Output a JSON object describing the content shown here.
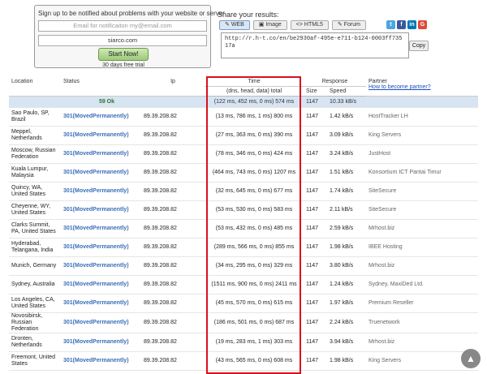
{
  "notify": {
    "label": "Sign up to be notified about problems with your website or server",
    "email_placeholder": "Email for notificaiton my@email.com",
    "domain_value": "siarco.com",
    "start_button": "Start Now!",
    "trial_text": "30 days free trial"
  },
  "share": {
    "title": "Share your results:",
    "tabs": [
      "WEB",
      "Image",
      "HTML5",
      "Forum"
    ],
    "url": "http://r.h-t.co/en/be2930af-495e-e711-b124-0003ff73517a",
    "copy_label": "Copy",
    "social": [
      {
        "name": "twitter-icon",
        "glyph": "t",
        "color": "#4da7de"
      },
      {
        "name": "facebook-icon",
        "glyph": "f",
        "color": "#3b5998"
      },
      {
        "name": "linkedin-icon",
        "glyph": "in",
        "color": "#0077b5"
      },
      {
        "name": "google-plus-icon",
        "glyph": "G",
        "color": "#dd4b39"
      }
    ]
  },
  "table": {
    "headers": {
      "location": "Location",
      "status": "Status",
      "ip": "Ip",
      "time": "Time",
      "time_sub": "(dns, head, data) total",
      "response": "Response",
      "size": "Size",
      "speed": "Speed",
      "partner": "Partner",
      "partner_link": "How to become partner?"
    },
    "summary": {
      "ok": "59 Ok",
      "time": "(122 ms, 452 ms, 0 ms) 574 ms",
      "size": "1147",
      "speed": "10.33 kB/s"
    },
    "rows": [
      {
        "location": "Sao Paulo, SP, Brazil",
        "status": "301(MovedPermanently)",
        "ip": "89.39.208.82",
        "time": "(13 ms, 786 ms, 1 ms) 800 ms",
        "size": "1147",
        "speed": "1.42 kB/s",
        "partner": "HostTracker LH"
      },
      {
        "location": "Meppel, Netherlands",
        "status": "301(MovedPermanently)",
        "ip": "89.39.208.82",
        "time": "(27 ms, 363 ms, 0 ms) 390 ms",
        "size": "1147",
        "speed": "3.09 kB/s",
        "partner": "King Servers"
      },
      {
        "location": "Moscow, Russian Federation",
        "status": "301(MovedPermanently)",
        "ip": "89.39.208.82",
        "time": "(78 ms, 346 ms, 0 ms) 424 ms",
        "size": "1147",
        "speed": "3.24 kB/s",
        "partner": "JustHost"
      },
      {
        "location": "Kuala Lumpur, Malaysia",
        "status": "301(MovedPermanently)",
        "ip": "89.39.208.82",
        "time": "(464 ms, 743 ms, 0 ms) 1207 ms",
        "size": "1147",
        "speed": "1.51 kB/s",
        "partner": "Konsortium ICT Pantai Timur"
      },
      {
        "location": "Quincy, WA, United States",
        "status": "301(MovedPermanently)",
        "ip": "89.39.208.82",
        "time": "(32 ms, 645 ms, 0 ms) 677 ms",
        "size": "1147",
        "speed": "1.74 kB/s",
        "partner": "SiteSecure"
      },
      {
        "location": "Cheyenne, WY, United States",
        "status": "301(MovedPermanently)",
        "ip": "89.39.208.82",
        "time": "(53 ms, 530 ms, 0 ms) 583 ms",
        "size": "1147",
        "speed": "2.11 kB/s",
        "partner": "SiteSecure"
      },
      {
        "location": "Clarks Summit, PA, United States",
        "status": "301(MovedPermanently)",
        "ip": "89.39.208.82",
        "time": "(53 ms, 432 ms, 0 ms) 485 ms",
        "size": "1147",
        "speed": "2.59 kB/s",
        "partner": "Mrhost.biz"
      },
      {
        "location": "Hyderabad, Telangana, India",
        "status": "301(MovedPermanently)",
        "ip": "89.39.208.82",
        "time": "(289 ms, 566 ms, 0 ms) 855 ms",
        "size": "1147",
        "speed": "1.98 kB/s",
        "partner": "IBEE Hosting"
      },
      {
        "location": "Munich, Germany",
        "status": "301(MovedPermanently)",
        "ip": "89.39.208.82",
        "time": "(34 ms, 295 ms, 0 ms) 329 ms",
        "size": "1147",
        "speed": "3.80 kB/s",
        "partner": "Mrhost.biz"
      },
      {
        "location": "Sydney, Australia",
        "status": "301(MovedPermanently)",
        "ip": "89.39.208.82",
        "time": "(1511 ms, 900 ms, 0 ms) 2411 ms",
        "size": "1147",
        "speed": "1.24 kB/s",
        "partner": "Sydney, MaxiDed Ltd."
      },
      {
        "location": "Los Angeles, CA, United States",
        "status": "301(MovedPermanently)",
        "ip": "89.39.208.82",
        "time": "(45 ms, 570 ms, 0 ms) 615 ms",
        "size": "1147",
        "speed": "1.97 kB/s",
        "partner": "Premium Reseller"
      },
      {
        "location": "Novosibirsk, Russian Federation",
        "status": "301(MovedPermanently)",
        "ip": "89.39.208.82",
        "time": "(186 ms, 501 ms, 0 ms) 687 ms",
        "size": "1147",
        "speed": "2.24 kB/s",
        "partner": "Truenetwork"
      },
      {
        "location": "Dronten, Netherlands",
        "status": "301(MovedPermanently)",
        "ip": "89.39.208.82",
        "time": "(19 ms, 283 ms, 1 ms) 303 ms",
        "size": "1147",
        "speed": "3.94 kB/s",
        "partner": "Mrhost.biz"
      },
      {
        "location": "Freemont, United States",
        "status": "301(MovedPermanently)",
        "ip": "89.39.208.82",
        "time": "(43 ms, 565 ms, 0 ms) 608 ms",
        "size": "1147",
        "speed": "1.98 kB/s",
        "partner": "King Servers"
      }
    ]
  },
  "scroll_top_glyph": "▲"
}
